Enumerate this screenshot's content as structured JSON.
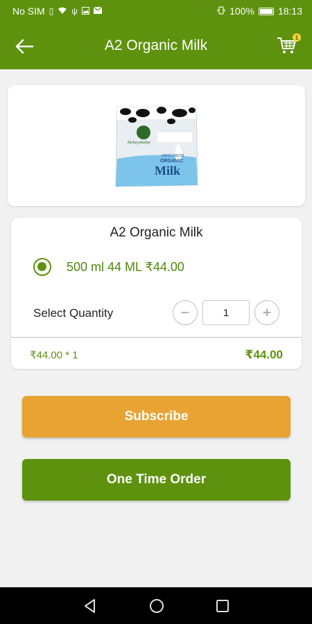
{
  "status_bar": {
    "carrier": "No SIM",
    "battery": "100%",
    "time": "18:13"
  },
  "app_bar": {
    "title": "A2 Organic Milk",
    "cart_count": "1"
  },
  "product": {
    "name": "A2 Organic Milk",
    "variant_label": "500 ml 44 ML ₹44.00",
    "variant_selected": true,
    "package_text": {
      "brand": "Akshayakalpa",
      "line1": "FARM FRESH",
      "line2": "ORGANIC",
      "line3": "Milk"
    }
  },
  "quantity": {
    "label": "Select Quantity",
    "value": "1",
    "minus": "−",
    "plus": "+"
  },
  "pricing": {
    "unit_line": "₹44.00 * 1",
    "total": "₹44.00"
  },
  "actions": {
    "subscribe": "Subscribe",
    "one_time": "One Time Order"
  },
  "colors": {
    "primary": "#5e920e",
    "subscribe": "#e8a332",
    "background": "#f1f1f1"
  },
  "icons": {
    "back": "arrow-left",
    "cart": "shopping-cart",
    "nav_back": "triangle-left",
    "nav_home": "circle",
    "nav_recent": "square"
  }
}
